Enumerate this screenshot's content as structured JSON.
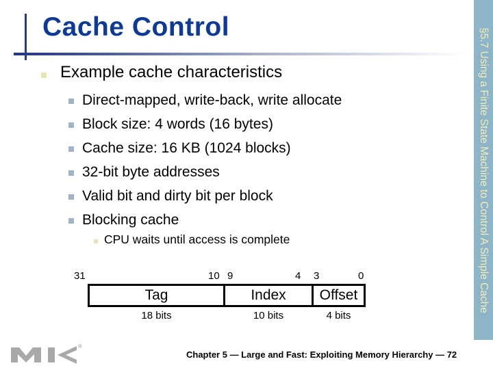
{
  "slide": {
    "title": "Cache Control",
    "section_label": "§5.7 Using a Finite State Machine to Control A Simple Cache",
    "bullets": {
      "main": "Example cache characteristics",
      "sub": [
        "Direct-mapped, write-back, write allocate",
        "Block size: 4 words (16 bytes)",
        "Cache size: 16 KB (1024 blocks)",
        "32-bit byte addresses",
        "Valid bit and dirty bit per block",
        "Blocking cache"
      ],
      "subsub": "CPU waits until access is complete"
    },
    "address_diagram": {
      "bit_numbers": {
        "b31": "31",
        "b10": "10",
        "b9": "9",
        "b4": "4",
        "b3": "3",
        "b0": "0"
      },
      "fields": [
        {
          "name": "Tag",
          "size": "18 bits"
        },
        {
          "name": "Index",
          "size": "10 bits"
        },
        {
          "name": "Offset",
          "size": "4 bits"
        }
      ]
    },
    "footer": "Chapter 5 — Large and Fast: Exploiting Memory Hierarchy — 72",
    "logo": {
      "text": "MK",
      "registered": "®"
    },
    "colors": {
      "title": "#0d3a96",
      "band": "#8db4c7",
      "band_text": "#f2edb8",
      "bullet_level1": "#e6e2b4",
      "bullet_level2": "#a0b4c6"
    }
  }
}
